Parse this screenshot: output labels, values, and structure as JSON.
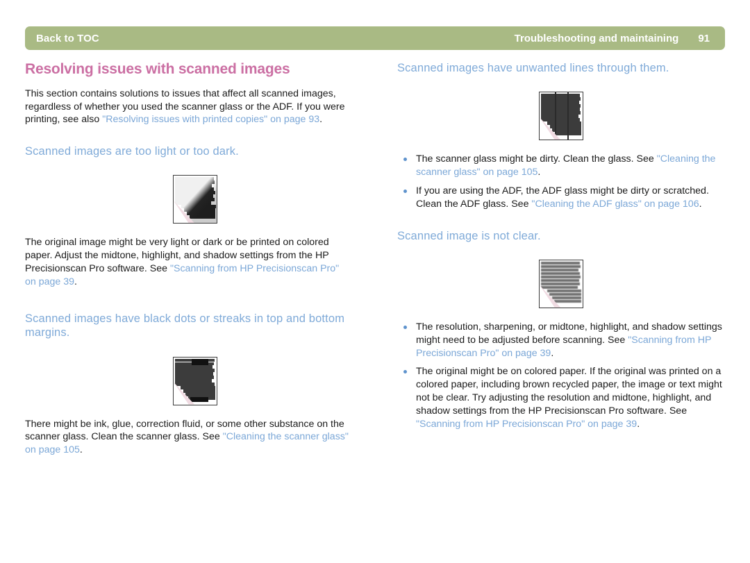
{
  "header": {
    "back_label": "Back to TOC",
    "section_title": "Troubleshooting and maintaining",
    "page_number": "91",
    "bar_color": "#a9ba84",
    "text_color": "#ffffff"
  },
  "colors": {
    "title_magenta": "#cb6fa3",
    "subhead_blue": "#7faad8",
    "link_blue": "#7ba7d7",
    "bullet_blue": "#5f93cd",
    "body_black": "#1a1a1a"
  },
  "left_column": {
    "title": "Resolving issues with scanned images",
    "intro": {
      "part1": "This section contains solutions to issues that affect all scanned images, regardless of whether you used the scanner glass or the ADF. If you were printing, see also ",
      "link1": "\"Resolving issues with printed copies\" on page 93",
      "part2": "."
    },
    "sections": [
      {
        "heading": "Scanned images are too light or too dark.",
        "figure_name": "scan-sample-light-dark",
        "body": {
          "part1": "The original image might be very light or dark or be printed on colored paper. Adjust the midtone, highlight, and shadow settings from the HP Precisionscan Pro software. See ",
          "link1": "\"Scanning from HP Precisionscan Pro\" on page 39",
          "part2": "."
        }
      },
      {
        "heading": "Scanned images have black dots or streaks in top and bottom margins.",
        "figure_name": "scan-sample-streaks",
        "body": {
          "part1": "There might be ink, glue, correction fluid, or some other substance on the scanner glass. Clean the scanner glass. See ",
          "link1": "\"Cleaning the scanner glass\" on page 105",
          "part2": "."
        }
      }
    ]
  },
  "right_column": {
    "sections": [
      {
        "heading": "Scanned images have unwanted lines through them.",
        "figure_name": "scan-sample-vertical-lines",
        "bullets": [
          {
            "part1": "The scanner glass might be dirty. Clean the glass. See ",
            "link1": "\"Cleaning the scanner glass\" on page 105",
            "part2": "."
          },
          {
            "part1": "If you are using the ADF, the ADF glass might be dirty or scratched. Clean the ADF glass. See ",
            "link1": "\"Cleaning the ADF glass\" on page 106",
            "part2": "."
          }
        ]
      },
      {
        "heading": "Scanned image is not clear.",
        "figure_name": "scan-sample-blurry",
        "bullets": [
          {
            "part1": "The resolution, sharpening, or midtone, highlight, and shadow settings might need to be adjusted before scanning. See ",
            "link1": "\"Scanning from HP Precisionscan Pro\" on page 39",
            "part2": "."
          },
          {
            "part1": "The original might be on colored paper. If the original was printed on a colored paper, including brown recycled paper, the image or text might not be clear. Try adjusting the resolution and midtone, highlight, and shadow settings from the HP Precisionscan Pro software. See ",
            "link1": "\"Scanning from HP Precisionscan Pro\" on page 39",
            "part2": "."
          }
        ]
      }
    ]
  }
}
